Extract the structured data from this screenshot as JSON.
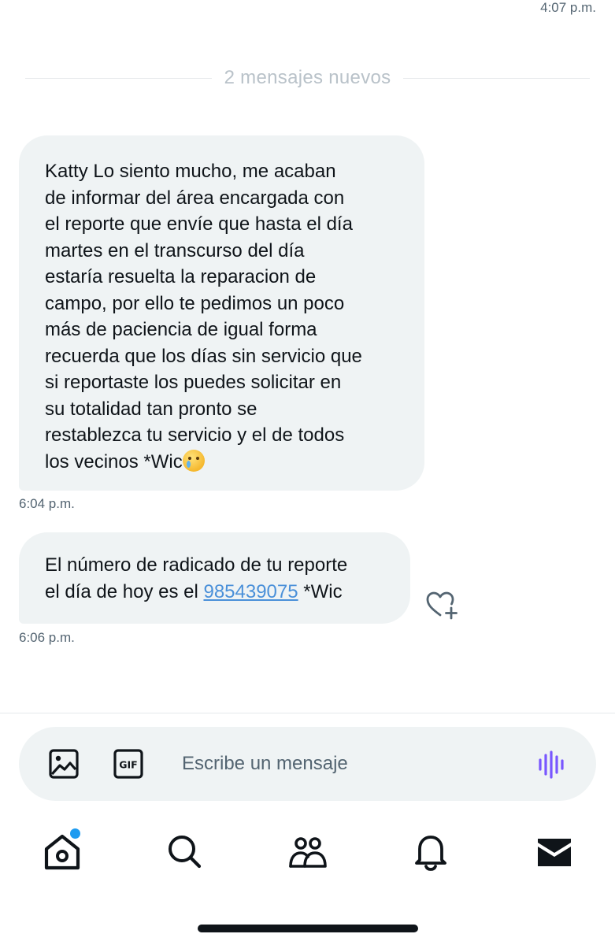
{
  "header": {
    "top_time": "4:07 p.m."
  },
  "divider": {
    "label": "2 mensajes nuevos"
  },
  "messages": [
    {
      "text": "Katty  Lo siento mucho, me acaban\nde informar del área encargada   con\nel reporte que envíe que hasta el día\nmartes en el transcurso del día\nestaría resuelta la reparacion de\ncampo, por ello te pedimos un poco\nmás de paciencia de igual forma\nrecuerda que los días sin servicio que\nsi reportaste los puedes solicitar en\nsu totalidad    tan pronto se\nrestablezca tu servicio y el de todos\nlos vecinos *Wic",
      "emoji": "crying-face",
      "time": "6:04 p.m."
    },
    {
      "text_before": "El número de radicado de tu reporte\nel día de hoy es el ",
      "link": "985439075",
      "text_after": " *Wic",
      "time": "6:06 p.m."
    }
  ],
  "composer": {
    "placeholder": "Escribe un mensaje",
    "image_icon": "image-icon",
    "gif_icon": "gif-icon",
    "voice_icon": "voice-wave-icon"
  },
  "nav": {
    "items": [
      "home-icon",
      "search-icon",
      "communities-icon",
      "bell-icon",
      "mail-icon"
    ],
    "home_has_notification_dot": true
  },
  "colors": {
    "bubble_bg": "#eff3f4",
    "link": "#4a90d9",
    "accent_voice": "#7856ff",
    "notification_dot": "#1d9bf0",
    "muted_text": "#536471"
  }
}
